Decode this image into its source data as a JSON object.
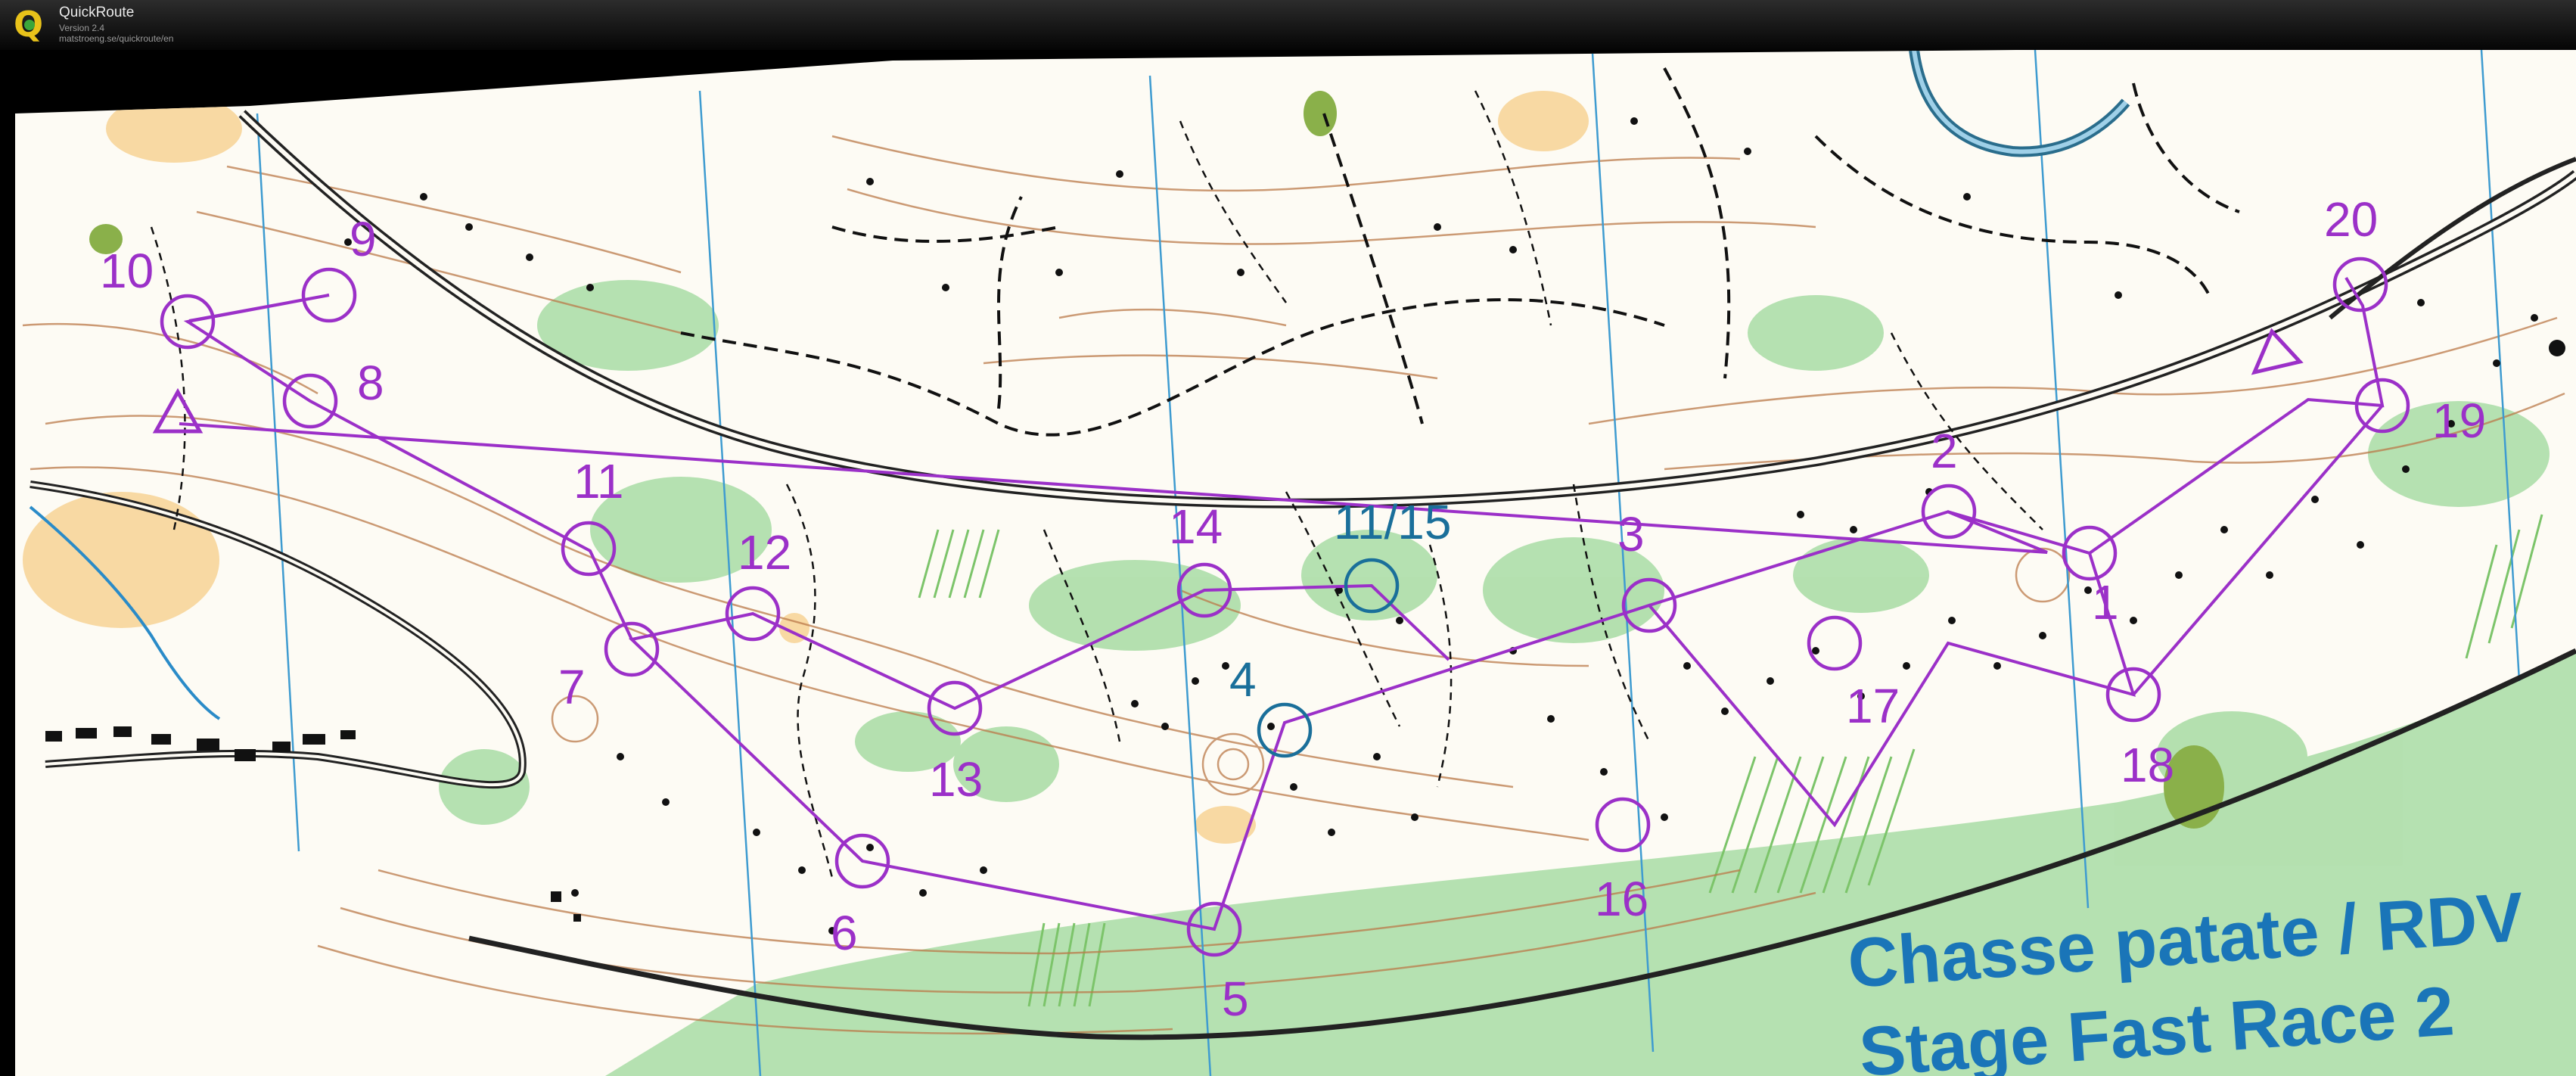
{
  "app": {
    "name": "QuickRoute",
    "version": "Version 2.4",
    "url": "matstroeng.se/quickroute/en"
  },
  "map": {
    "title_line1": "Chasse patate / RDV",
    "title_line2": "Stage Fast Race 2",
    "colors": {
      "course": "#9b30c8",
      "course_alt": "#1a6f9a",
      "title": "#1a75b8",
      "vegetation": "#9ed69a",
      "open": "#f5d08a",
      "contours": "#b86a3c",
      "water": "#2a6d8c"
    },
    "control_labels": {
      "c1": "1",
      "c2": "2",
      "c3": "3",
      "c4": "4",
      "c5": "5",
      "c6": "6",
      "c7": "7",
      "c8": "8",
      "c9": "9",
      "c10": "10",
      "c11": "11",
      "c12": "12",
      "c13": "13",
      "c14": "14",
      "c11_15": "11/15",
      "c16": "16",
      "c17": "17",
      "c18": "18",
      "c19": "19",
      "c20": "20"
    }
  }
}
